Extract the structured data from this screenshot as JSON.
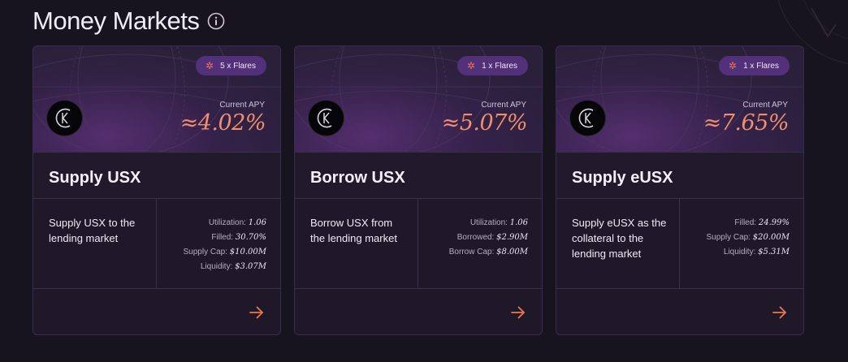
{
  "page": {
    "title": "Money Markets",
    "info_icon": "info-circle-icon"
  },
  "colors": {
    "background": "#17131f",
    "card_bg": "#1e1829",
    "accent_orange": "#f08e6d",
    "badge_bg": "#53307a",
    "flare_icon": "#f0754a"
  },
  "cards": [
    {
      "flare_badge": "5 x Flares",
      "apy_label": "Current APY",
      "apy_value": "≈4.02%",
      "title": "Supply USX",
      "description": "Supply USX to the lending market",
      "stats": [
        {
          "label": "Utilization:",
          "value": "1.06"
        },
        {
          "label": "Filled:",
          "value": "30.70%"
        },
        {
          "label": "Supply Cap:",
          "value": "$10.00M"
        },
        {
          "label": "Liquidity:",
          "value": "$3.07M"
        }
      ]
    },
    {
      "flare_badge": "1 x Flares",
      "apy_label": "Current APY",
      "apy_value": "≈5.07%",
      "title": "Borrow USX",
      "description": "Borrow USX from the lending market",
      "stats": [
        {
          "label": "Utilization:",
          "value": "1.06"
        },
        {
          "label": "Borrowed:",
          "value": "$2.90M"
        },
        {
          "label": "Borrow Cap:",
          "value": "$8.00M"
        }
      ]
    },
    {
      "flare_badge": "1 x Flares",
      "apy_label": "Current APY",
      "apy_value": "≈7.65%",
      "title": "Supply eUSX",
      "description": "Supply eUSX as the collateral to the lending market",
      "stats": [
        {
          "label": "Filled:",
          "value": "24.99%"
        },
        {
          "label": "Supply Cap:",
          "value": "$20.00M"
        },
        {
          "label": "Liquidity:",
          "value": "$5.31M"
        }
      ]
    }
  ]
}
